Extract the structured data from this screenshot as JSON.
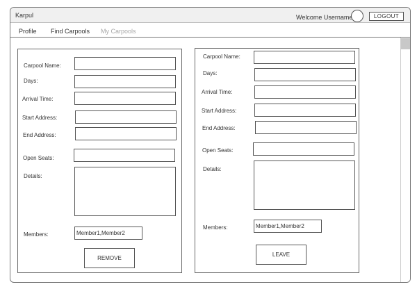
{
  "app": {
    "title": "Karpul",
    "welcome": "Welcome Username",
    "logout_label": "LOGOUT"
  },
  "nav": {
    "tabs": [
      {
        "label": "Profile",
        "state": "normal"
      },
      {
        "label": "Find Carpools",
        "state": "normal"
      },
      {
        "label": "My Carpools",
        "state": "disabled"
      }
    ]
  },
  "left_panel": {
    "labels": {
      "name": "Carpool Name:",
      "days": "Days:",
      "arrival": "Arrival Time:",
      "start": "Start Address:",
      "end": "End Address:",
      "seats": "Open Seats:",
      "details": "Details:",
      "members": "Members:"
    },
    "members_value": "Member1,Member2",
    "button_label": "REMOVE"
  },
  "right_panel": {
    "labels": {
      "name": "Carpool Name:",
      "days": "Days:",
      "arrival": "Arrival Time:",
      "start": "Start Address:",
      "end": "End Address:",
      "seats": "Open Seats:",
      "details": "Details:",
      "members": "Members:"
    },
    "members_value": "Member1,Member2",
    "button_label": "LEAVE"
  }
}
